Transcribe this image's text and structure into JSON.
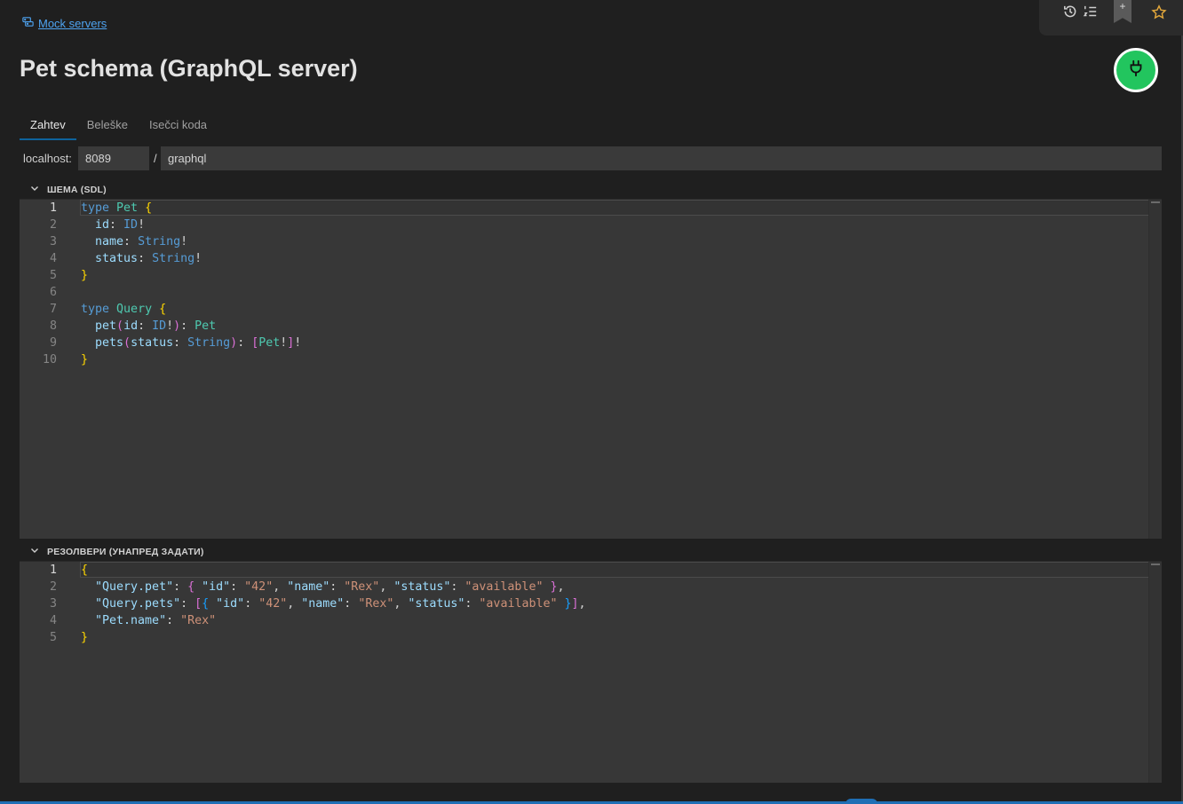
{
  "breadcrumb": {
    "label": "Mock servers",
    "icon": "mock-server-icon"
  },
  "title": "Pet schema (GraphQL server)",
  "connect_button": {
    "icon": "plug-icon",
    "color": "#22c55e"
  },
  "toolbar": {
    "icons": [
      "history-icon",
      "ordered-list-icon",
      "bookmark-add-icon",
      "star-icon"
    ],
    "bookmark_plus": "+",
    "star_color": "#e2a73b"
  },
  "tabs": [
    {
      "label": "Zahtev",
      "active": true
    },
    {
      "label": "Beleške",
      "active": false
    },
    {
      "label": "Isečci koda",
      "active": false
    }
  ],
  "url": {
    "host_label": "localhost:",
    "port": "8089",
    "separator": "/",
    "path": "graphql"
  },
  "schema_section": {
    "label": "ШЕМА (SDL)",
    "line_numbers": [
      "1",
      "2",
      "3",
      "4",
      "5",
      "6",
      "7",
      "8",
      "9",
      "10"
    ],
    "lines": [
      [
        [
          "kw",
          "type"
        ],
        [
          "pu",
          " "
        ],
        [
          "ty",
          "Pet"
        ],
        [
          "pu",
          " "
        ],
        [
          "b1",
          "{"
        ]
      ],
      [
        [
          "pu",
          "  "
        ],
        [
          "id",
          "id"
        ],
        [
          "pu",
          ": "
        ],
        [
          "kw",
          "ID"
        ],
        [
          "pu",
          "!"
        ]
      ],
      [
        [
          "pu",
          "  "
        ],
        [
          "id",
          "name"
        ],
        [
          "pu",
          ": "
        ],
        [
          "kw",
          "String"
        ],
        [
          "pu",
          "!"
        ]
      ],
      [
        [
          "pu",
          "  "
        ],
        [
          "id",
          "status"
        ],
        [
          "pu",
          ": "
        ],
        [
          "kw",
          "String"
        ],
        [
          "pu",
          "!"
        ]
      ],
      [
        [
          "b1",
          "}"
        ]
      ],
      [],
      [
        [
          "kw",
          "type"
        ],
        [
          "pu",
          " "
        ],
        [
          "ty",
          "Query"
        ],
        [
          "pu",
          " "
        ],
        [
          "b1",
          "{"
        ]
      ],
      [
        [
          "pu",
          "  "
        ],
        [
          "id",
          "pet"
        ],
        [
          "b2",
          "("
        ],
        [
          "id",
          "id"
        ],
        [
          "pu",
          ": "
        ],
        [
          "kw",
          "ID"
        ],
        [
          "pu",
          "!"
        ],
        [
          "b2",
          ")"
        ],
        [
          "pu",
          ": "
        ],
        [
          "ty",
          "Pet"
        ]
      ],
      [
        [
          "pu",
          "  "
        ],
        [
          "id",
          "pets"
        ],
        [
          "b2",
          "("
        ],
        [
          "id",
          "status"
        ],
        [
          "pu",
          ": "
        ],
        [
          "kw",
          "String"
        ],
        [
          "b2",
          ")"
        ],
        [
          "pu",
          ": "
        ],
        [
          "b2",
          "["
        ],
        [
          "ty",
          "Pet"
        ],
        [
          "pu",
          "!"
        ],
        [
          "b2",
          "]"
        ],
        [
          "pu",
          "!"
        ]
      ],
      [
        [
          "b1",
          "}"
        ]
      ]
    ]
  },
  "resolvers_section": {
    "label": "РЕЗОЛВЕРИ (УНАПРЕД ЗАДАТИ)",
    "line_numbers": [
      "1",
      "2",
      "3",
      "4",
      "5"
    ],
    "lines": [
      [
        [
          "b1",
          "{"
        ]
      ],
      [
        [
          "pu",
          "  "
        ],
        [
          "key",
          "\"Query.pet\""
        ],
        [
          "pu",
          ": "
        ],
        [
          "b2",
          "{"
        ],
        [
          "pu",
          " "
        ],
        [
          "key",
          "\"id\""
        ],
        [
          "pu",
          ": "
        ],
        [
          "str",
          "\"42\""
        ],
        [
          "pu",
          ", "
        ],
        [
          "key",
          "\"name\""
        ],
        [
          "pu",
          ": "
        ],
        [
          "str",
          "\"Rex\""
        ],
        [
          "pu",
          ", "
        ],
        [
          "key",
          "\"status\""
        ],
        [
          "pu",
          ": "
        ],
        [
          "str",
          "\"available\""
        ],
        [
          "pu",
          " "
        ],
        [
          "b2",
          "}"
        ],
        [
          "pu",
          ","
        ]
      ],
      [
        [
          "pu",
          "  "
        ],
        [
          "key",
          "\"Query.pets\""
        ],
        [
          "pu",
          ": "
        ],
        [
          "b2",
          "["
        ],
        [
          "b3",
          "{"
        ],
        [
          "pu",
          " "
        ],
        [
          "key",
          "\"id\""
        ],
        [
          "pu",
          ": "
        ],
        [
          "str",
          "\"42\""
        ],
        [
          "pu",
          ", "
        ],
        [
          "key",
          "\"name\""
        ],
        [
          "pu",
          ": "
        ],
        [
          "str",
          "\"Rex\""
        ],
        [
          "pu",
          ", "
        ],
        [
          "key",
          "\"status\""
        ],
        [
          "pu",
          ": "
        ],
        [
          "str",
          "\"available\""
        ],
        [
          "pu",
          " "
        ],
        [
          "b3",
          "}"
        ],
        [
          "b2",
          "]"
        ],
        [
          "pu",
          ","
        ]
      ],
      [
        [
          "pu",
          "  "
        ],
        [
          "key",
          "\"Pet.name\""
        ],
        [
          "pu",
          ": "
        ],
        [
          "str",
          "\"Rex\""
        ]
      ],
      [
        [
          "b1",
          "}"
        ]
      ]
    ]
  }
}
